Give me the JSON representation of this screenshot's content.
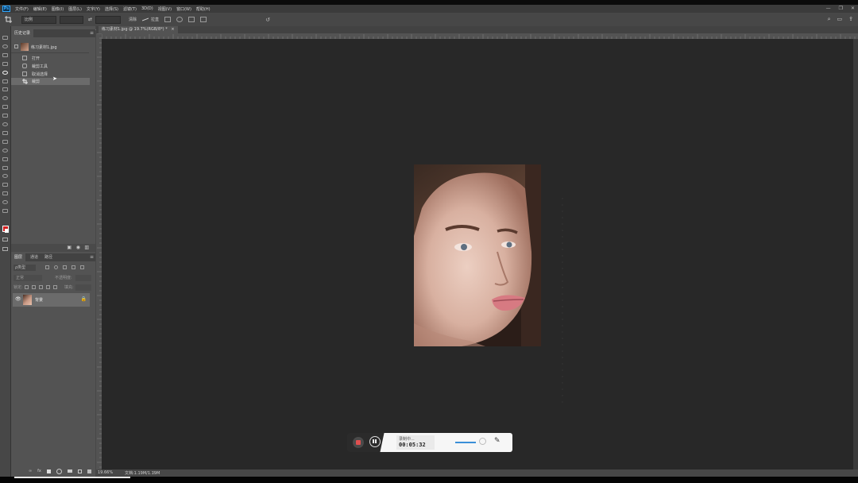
{
  "app": {
    "logo": "Ps",
    "menu": [
      "文件(F)",
      "编辑(E)",
      "图像(I)",
      "图层(L)",
      "文字(Y)",
      "选择(S)",
      "滤镜(T)",
      "3D(D)",
      "视图(V)",
      "窗口(W)",
      "帮助(H)"
    ],
    "window_controls": [
      "—",
      "❐",
      "✕"
    ]
  },
  "options": {
    "ratio_label": "比例",
    "clear_label": "清除",
    "straighten_label": "拉直"
  },
  "panels": {
    "history": {
      "tab": "历史记录",
      "snapshot_label": "练习素材1.jpg",
      "items": [
        {
          "label": "打开"
        },
        {
          "label": "裁剪工具"
        },
        {
          "label": "取消选择"
        },
        {
          "label": "裁剪"
        }
      ]
    },
    "layers": {
      "tabs": [
        "图层",
        "通道",
        "路径"
      ],
      "filter_label": "ρ类型",
      "blend_mode": "正常",
      "opacity_label": "不透明度:",
      "lock_label": "锁定:",
      "fill_label": "填充:",
      "layer_name": "背景"
    }
  },
  "document": {
    "tab_title": "练习素材1.jpg @ 19.7%(RGB/8*) *",
    "zoom": "19.66%",
    "doc_info": "文档:1.19M/1.19M"
  },
  "recorder": {
    "status": "录制中...",
    "time": "00:05:32"
  },
  "colors": {
    "accent": "#31a8ff",
    "canvas": "#282828",
    "panel": "#535353",
    "record_red": "#e05050"
  }
}
